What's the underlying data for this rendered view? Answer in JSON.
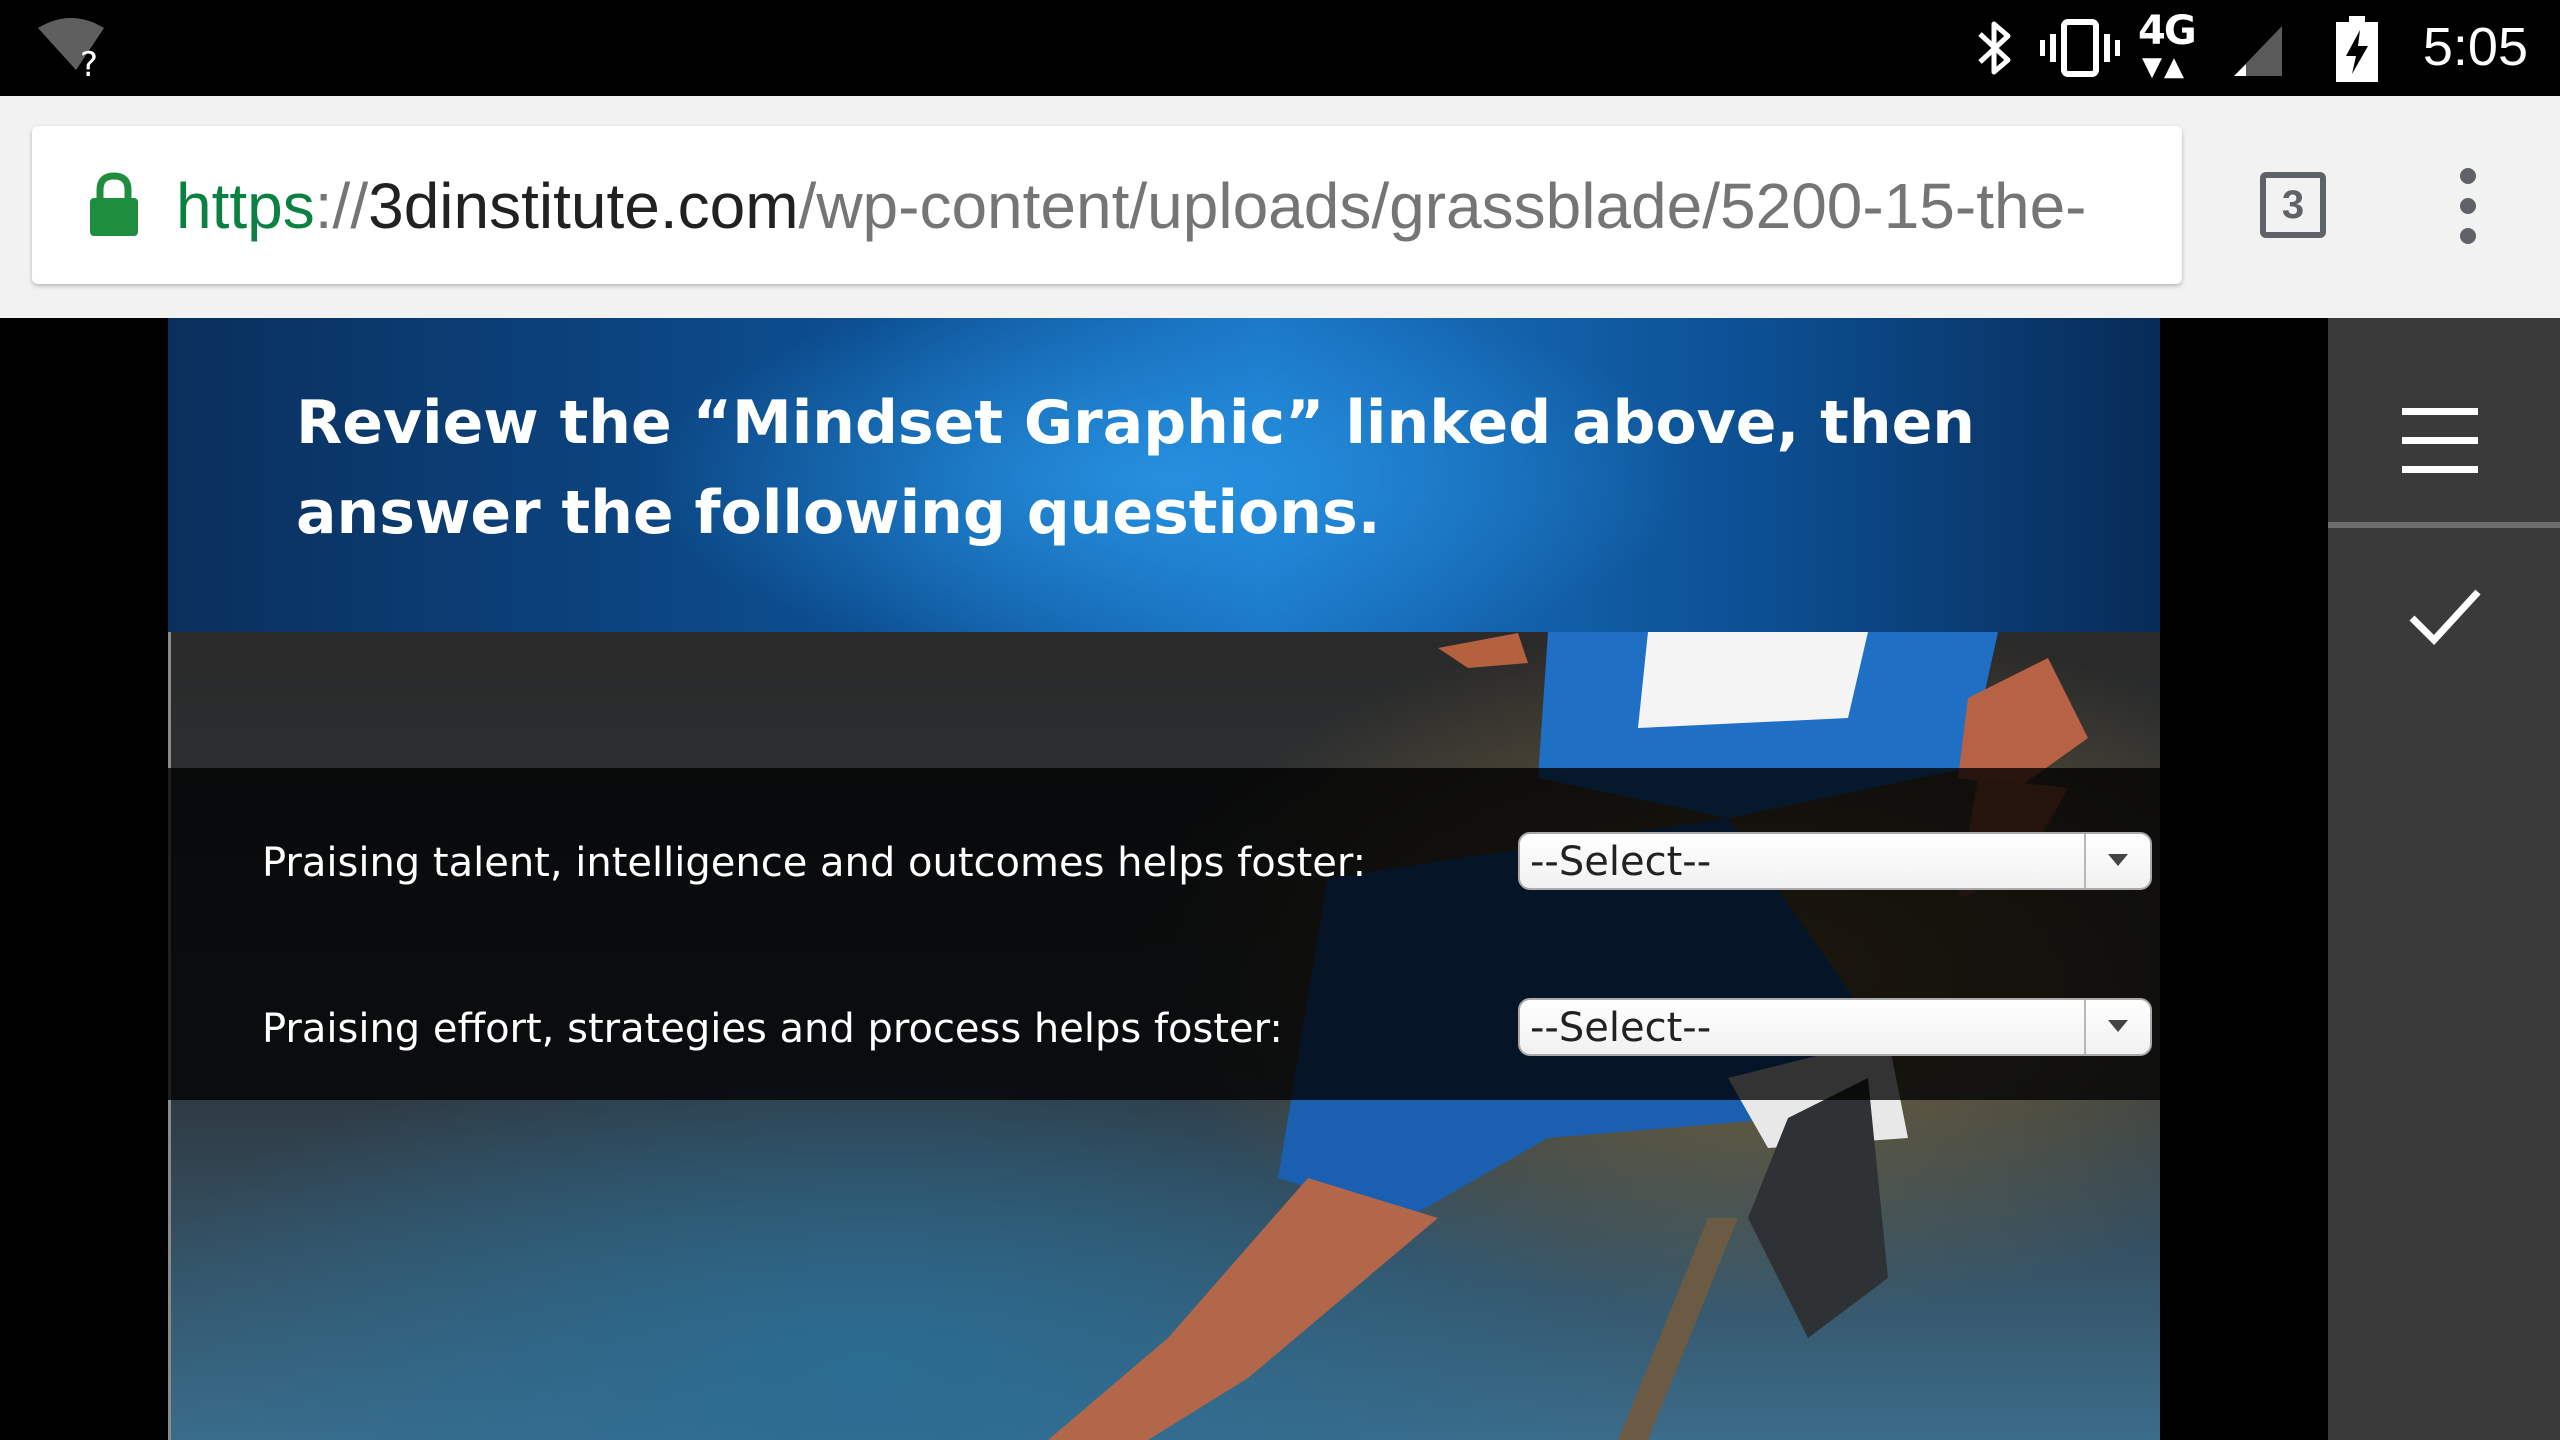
{
  "status_bar": {
    "time": "5:05",
    "network": "4G",
    "network_sub": "LTE",
    "icons": [
      "wifi-unknown-icon",
      "bluetooth-icon",
      "vibrate-icon",
      "lte-data-icon",
      "signal-icon",
      "battery-charging-icon"
    ]
  },
  "browser": {
    "url": {
      "scheme": "https",
      "separator": "://",
      "host": "3dinstitute.com",
      "path": "/wp-content/uploads/grassblade/5200-15-the-"
    },
    "tab_count": "3",
    "colors": {
      "secure_green": "#0b8043",
      "lock_green": "#1e8e3e"
    }
  },
  "slide": {
    "title": "Review the “Mindset Graphic” linked above, then answer the following questions.",
    "questions": [
      {
        "label": "Praising talent, intelligence and outcomes helps foster:",
        "selected": "--Select--"
      },
      {
        "label": "Praising effort, strategies and process helps foster:",
        "selected": "--Select--"
      }
    ]
  },
  "side_nav": {
    "icons": [
      "hamburger-menu-icon",
      "checkmark-icon"
    ]
  }
}
